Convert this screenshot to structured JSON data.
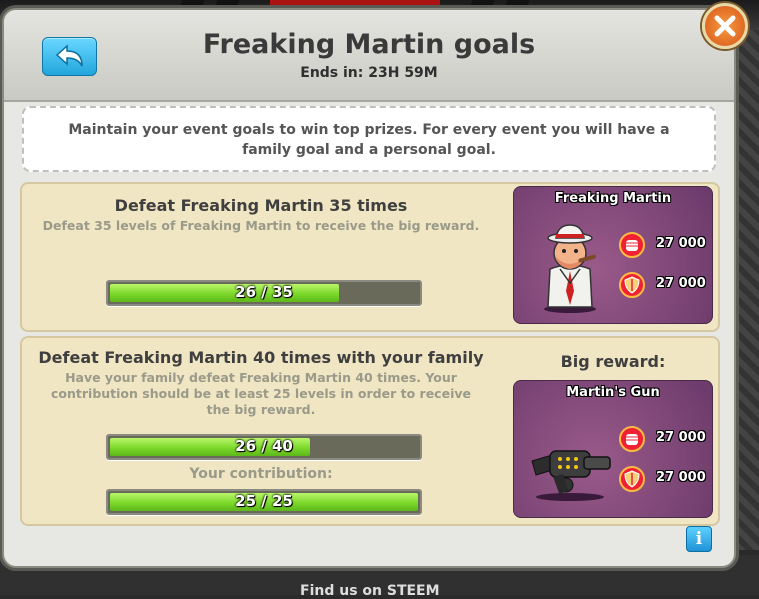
{
  "header": {
    "title": "Freaking Martin goals",
    "subtitle": "Ends in: 23H 59M"
  },
  "intro": {
    "text": "Maintain your event goals to win top prizes. For every event you will have a family goal and a personal goal."
  },
  "personal_goal": {
    "title": "Defeat Freaking Martin 35 times",
    "description": "Defeat 35 levels of Freaking Martin to receive the big reward.",
    "progress_text": "26 / 35",
    "progress": 0.743,
    "reward": {
      "name": "Freaking Martin",
      "image_icon": "mobster-character",
      "items": [
        {
          "icon": "fist-power-icon",
          "value": "27 000"
        },
        {
          "icon": "shield-defense-icon",
          "value": "27 000"
        }
      ]
    }
  },
  "family_goal": {
    "title": "Defeat Freaking Martin 40 times with your family",
    "description": "Have your family defeat Freaking Martin 40 times. Your contribution should be at least 25 levels in order to receive the big reward.",
    "progress_text": "26 / 40",
    "progress": 0.65,
    "contribution_label": "Your contribution:",
    "contribution_text": "25 / 25",
    "contribution_progress": 1.0,
    "big_reward_label": "Big reward:",
    "reward": {
      "name": "Martin's Gun",
      "image_icon": "gatling-gun",
      "items": [
        {
          "icon": "fist-power-icon",
          "value": "27 000"
        },
        {
          "icon": "shield-defense-icon",
          "value": "27 000"
        }
      ]
    }
  },
  "footer": {
    "text": "Find us on STEEM"
  },
  "colors": {
    "accent_blue": "#21a6dc",
    "close_orange": "#d5551a",
    "progress_green": "#7cd82a",
    "card_bg": "#f1e6c3",
    "reward_purple": "#6a3a6a"
  }
}
